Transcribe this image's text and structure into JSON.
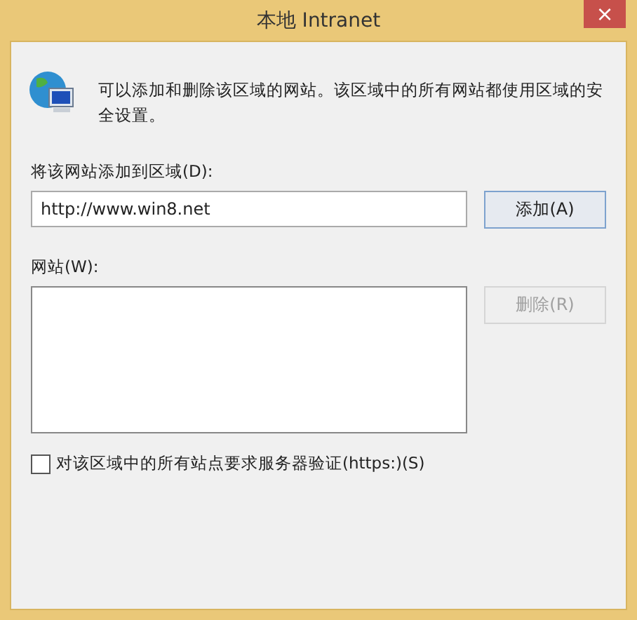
{
  "window": {
    "title": "本地 Intranet",
    "close": "×"
  },
  "description": "可以添加和删除该区域的网站。该区域中的所有网站都使用区域的安全设置。",
  "add_label": "将该网站添加到区域(D):",
  "url_field": {
    "value": "http://www.win8.net"
  },
  "add_button": {
    "label": "添加(A)",
    "disabled": false
  },
  "websites_label": "网站(W):",
  "remove_button": {
    "label": "删除(R)",
    "disabled": true
  },
  "https_checkbox": {
    "label": "对该区域中的所有站点要求服务器验证(https:)(S)",
    "checked": false
  }
}
